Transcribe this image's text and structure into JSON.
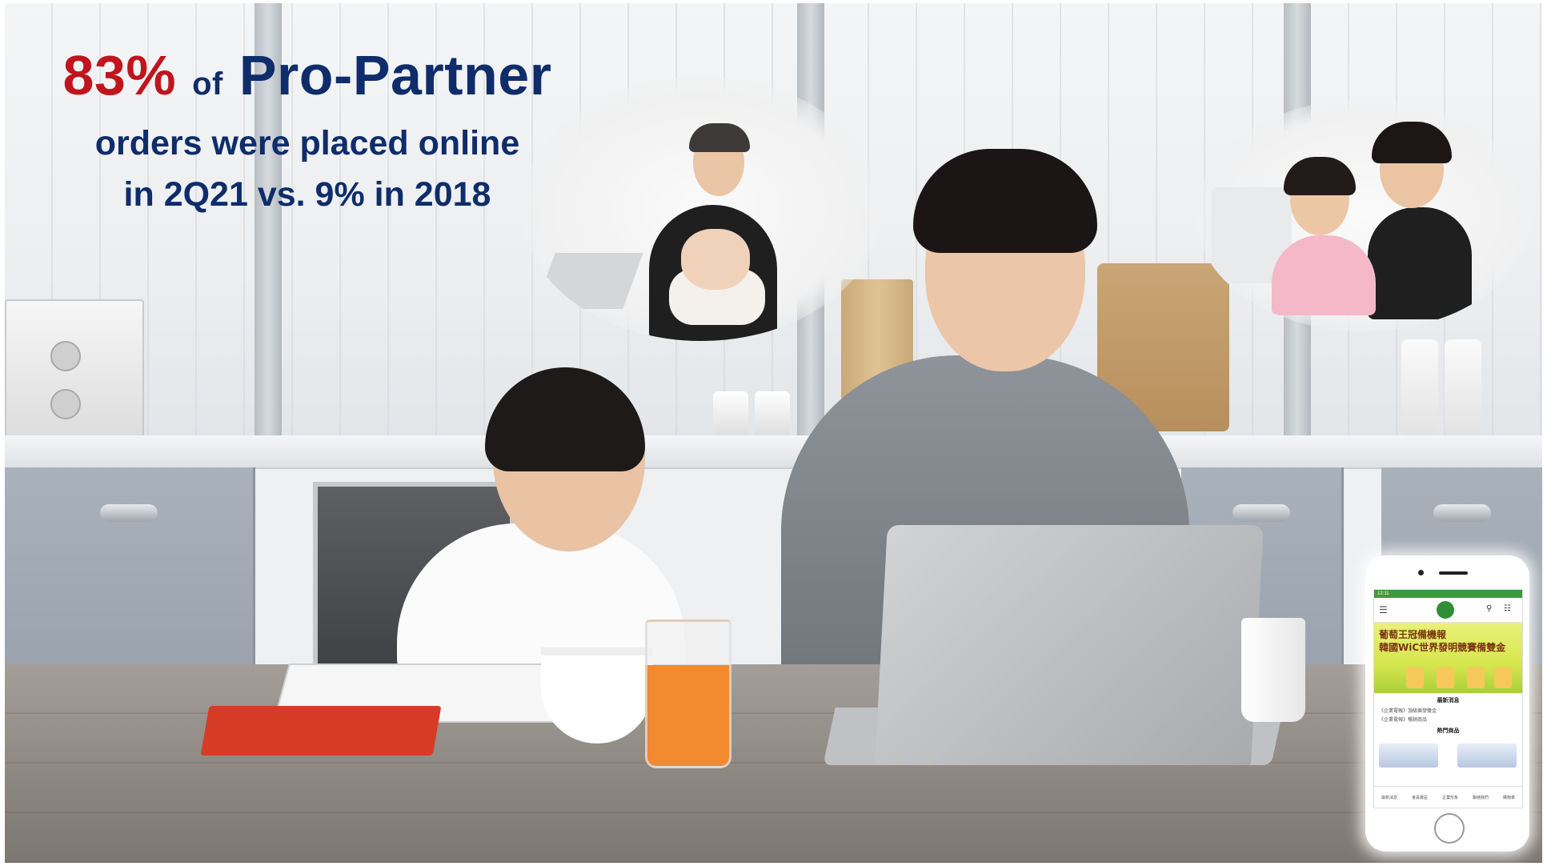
{
  "headline": {
    "percent": "83%",
    "of": "of",
    "brand": "Pro-Partner",
    "line2": "orders were placed online",
    "line3": "in 2Q21 vs. 9% in 2018"
  },
  "phone": {
    "status_time": "12:11",
    "banner_line1": "葡萄王冠備機報",
    "banner_line2": "韓國WiC世界發明競賽備雙金",
    "section_news": "最新消息",
    "section_products": "熱門商品",
    "news_items": [
      "《企業電報》頂級樂發雙金",
      "《企業電報》暢銷商品"
    ],
    "nav_items": [
      "最新消息",
      "會員專區",
      "企業形象",
      "聯絡我們",
      "購物車"
    ]
  },
  "colors": {
    "headline_blue": "#0f2d6b",
    "headline_red": "#c0151f",
    "app_green": "#3d9a3c"
  }
}
